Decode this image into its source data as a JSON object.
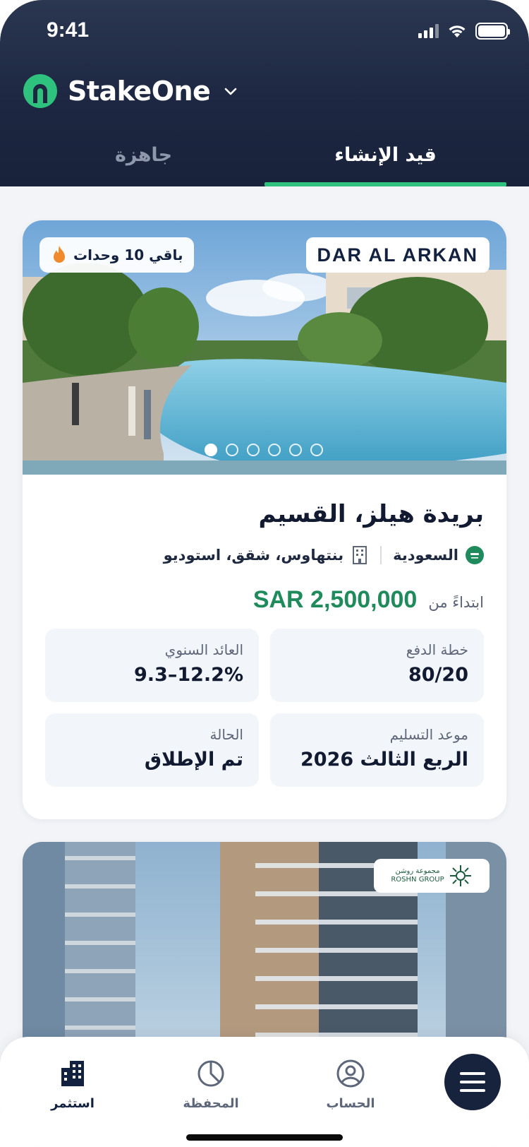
{
  "status_bar": {
    "time": "9:41"
  },
  "header": {
    "brand": "StakeOne",
    "tabs": [
      {
        "label": "قيد الإنشاء",
        "active": true
      },
      {
        "label": "جاهزة",
        "active": false
      }
    ]
  },
  "projects": [
    {
      "developer": "DAR AL ARKAN",
      "units_left": "باقي 10 وحدات",
      "slides_total": 6,
      "slide_active": 1,
      "title": "بريدة هيلز، القسيم",
      "country": "السعودية",
      "types": "بنتهاوس، شقق، استوديو",
      "price_prefix": "ابتداءً من",
      "price": "SAR 2,500,000",
      "stats": [
        {
          "label": "خطة الدفع",
          "value": "80/20"
        },
        {
          "label": "العائد السنوي",
          "value": "9.3–12.2%"
        },
        {
          "label": "موعد التسليم",
          "value": "الربع الثالث 2026"
        },
        {
          "label": "الحالة",
          "value": "تم الإطلاق"
        }
      ]
    },
    {
      "developer_ar": "مجموعة روشن",
      "developer_en": "ROSHN GROUP"
    }
  ],
  "nav": [
    {
      "label": "استثمر",
      "icon": "buildings-icon",
      "active": true
    },
    {
      "label": "المحفظة",
      "icon": "pie-chart-icon",
      "active": false
    },
    {
      "label": "الحساب",
      "icon": "user-circle-icon",
      "active": false
    }
  ],
  "colors": {
    "header": "#1d2741",
    "accent_green": "#2ec27e",
    "price_green": "#1f8a5b",
    "dark": "#17223c"
  }
}
